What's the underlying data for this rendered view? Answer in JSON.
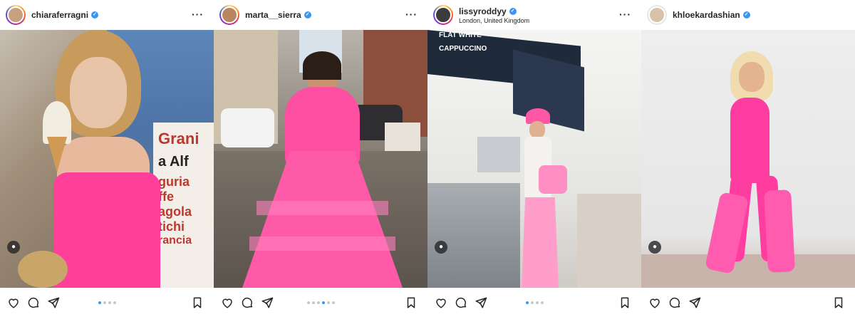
{
  "posts": [
    {
      "username": "chiaraferragni",
      "location": "",
      "verified": true,
      "carousel": {
        "count": 4,
        "active": 1
      },
      "photo_sign": [
        "Grani",
        "a Alf",
        "guria",
        "ffe",
        "agola",
        "tichi",
        "rancia"
      ],
      "icons": {
        "like": "heart-icon",
        "comment": "comment-icon",
        "share": "send-icon",
        "save": "bookmark-icon",
        "tag": "user-tag-icon",
        "more": "more-icon"
      }
    },
    {
      "username": "marta__sierra",
      "location": "",
      "verified": true,
      "carousel": {
        "count": 6,
        "active": 4
      },
      "icons": {
        "like": "heart-icon",
        "comment": "comment-icon",
        "share": "send-icon",
        "save": "bookmark-icon",
        "tag": "user-tag-icon",
        "more": "more-icon"
      }
    },
    {
      "username": "lissyroddyy",
      "location": "London, United Kingdom",
      "verified": true,
      "carousel": {
        "count": 4,
        "active": 1
      },
      "photo_sign": [
        "FLAT WHITE",
        "CAPPUCCINO"
      ],
      "icons": {
        "like": "heart-icon",
        "comment": "comment-icon",
        "share": "send-icon",
        "save": "bookmark-icon",
        "tag": "user-tag-icon",
        "more": "more-icon"
      }
    },
    {
      "username": "khloekardashian",
      "location": "",
      "verified": true,
      "carousel": {
        "count": 0,
        "active": 0
      },
      "icons": {
        "like": "heart-icon",
        "comment": "comment-icon",
        "share": "send-icon",
        "save": "bookmark-icon",
        "tag": "user-tag-icon"
      }
    }
  ],
  "colors": {
    "accent": "#3897f0",
    "text": "#262626",
    "pink": "#ff4fa3"
  }
}
